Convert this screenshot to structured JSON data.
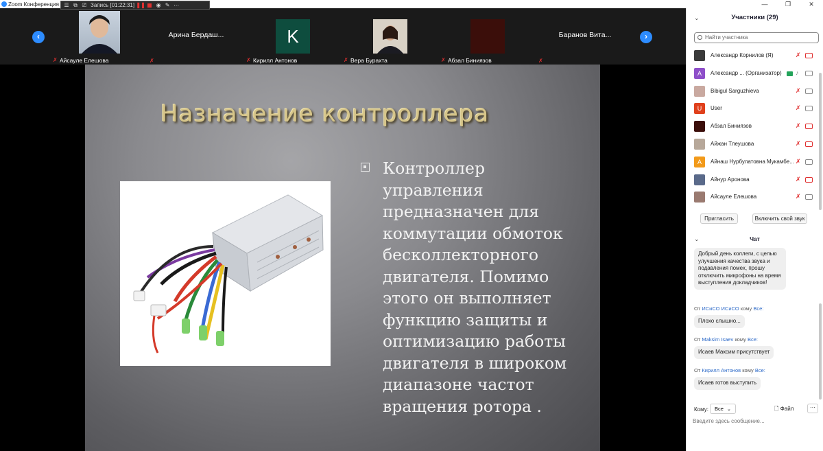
{
  "app": {
    "title": "Zoom Конференция"
  },
  "recording": {
    "label": "Запись [01:22:31]"
  },
  "video_strip": {
    "tiles": [
      {
        "name": "Айсауле Елешова"
      },
      {
        "name": "",
        "center_name": "Арина  Бердаш..."
      },
      {
        "name": "Кирилл Антонов",
        "initial": "K"
      },
      {
        "name": "Вера Бурахта"
      },
      {
        "name": "Абзал Биниязов"
      },
      {
        "name": "",
        "center_name": "Баранов  Вита..."
      }
    ]
  },
  "slide": {
    "title": "Назначение контроллера",
    "body": "Контроллер управления предназначен для коммутации обмоток бесколлекторного двигателя. Помимо этого он выполняет функцию защиты и оптимизацию работы двигателя в широком диапазоне частот вращения ротора ."
  },
  "participants": {
    "title": "Участники (29)",
    "search_placeholder": "Найти участника",
    "list": [
      {
        "name": "Александр Корнилов (Я)",
        "avatar_color": "#3a3a3a",
        "initial": ""
      },
      {
        "name": "Александр ...  (Организатор)",
        "avatar_color": "#8e4fc9",
        "initial": "A"
      },
      {
        "name": "Bibigul Sarguzhieva",
        "avatar_color": "#c9a9a0",
        "initial": ""
      },
      {
        "name": "User",
        "avatar_color": "#e0401c",
        "initial": "U"
      },
      {
        "name": "Абзал Биниязов",
        "avatar_color": "#3b0e0a",
        "initial": ""
      },
      {
        "name": "Айжан Тлеушова",
        "avatar_color": "#b7a89a",
        "initial": ""
      },
      {
        "name": "Айнаш Нурбулатовна Мукамбе...",
        "avatar_color": "#f29a1a",
        "initial": "A"
      },
      {
        "name": "Айнур Аронова",
        "avatar_color": "#5a6a8a",
        "initial": ""
      },
      {
        "name": "Айсауле Елешова",
        "avatar_color": "#9a7a70",
        "initial": ""
      }
    ],
    "invite_label": "Пригласить",
    "unmute_label": "Включить свой звук"
  },
  "chat": {
    "title": "Чат",
    "messages": [
      {
        "from": "",
        "to": "",
        "text": "Добрый день коллеги, с целью улучшения качества звука и подавления помех, прошу отключить микрофоны на время выступления докладчиков!"
      },
      {
        "from_prefix": "От",
        "from": "ИСиСО ИСиСО",
        "to_prefix": "кому",
        "to": "Все:",
        "text": "Плохо слышно..."
      },
      {
        "from_prefix": "От",
        "from": "Maksim Isaev",
        "to_prefix": "кому",
        "to": "Все:",
        "text": "Исаев Максим присутствует"
      },
      {
        "from_prefix": "От",
        "from": "Кирилл Антонов",
        "to_prefix": "кому",
        "to": "Все:",
        "text": "Исаев готов выступить"
      }
    ],
    "to_label": "Кому:",
    "to_value": "Все",
    "file_label": "Файл",
    "more_label": "···",
    "input_placeholder": "Введите здесь сообщение..."
  }
}
